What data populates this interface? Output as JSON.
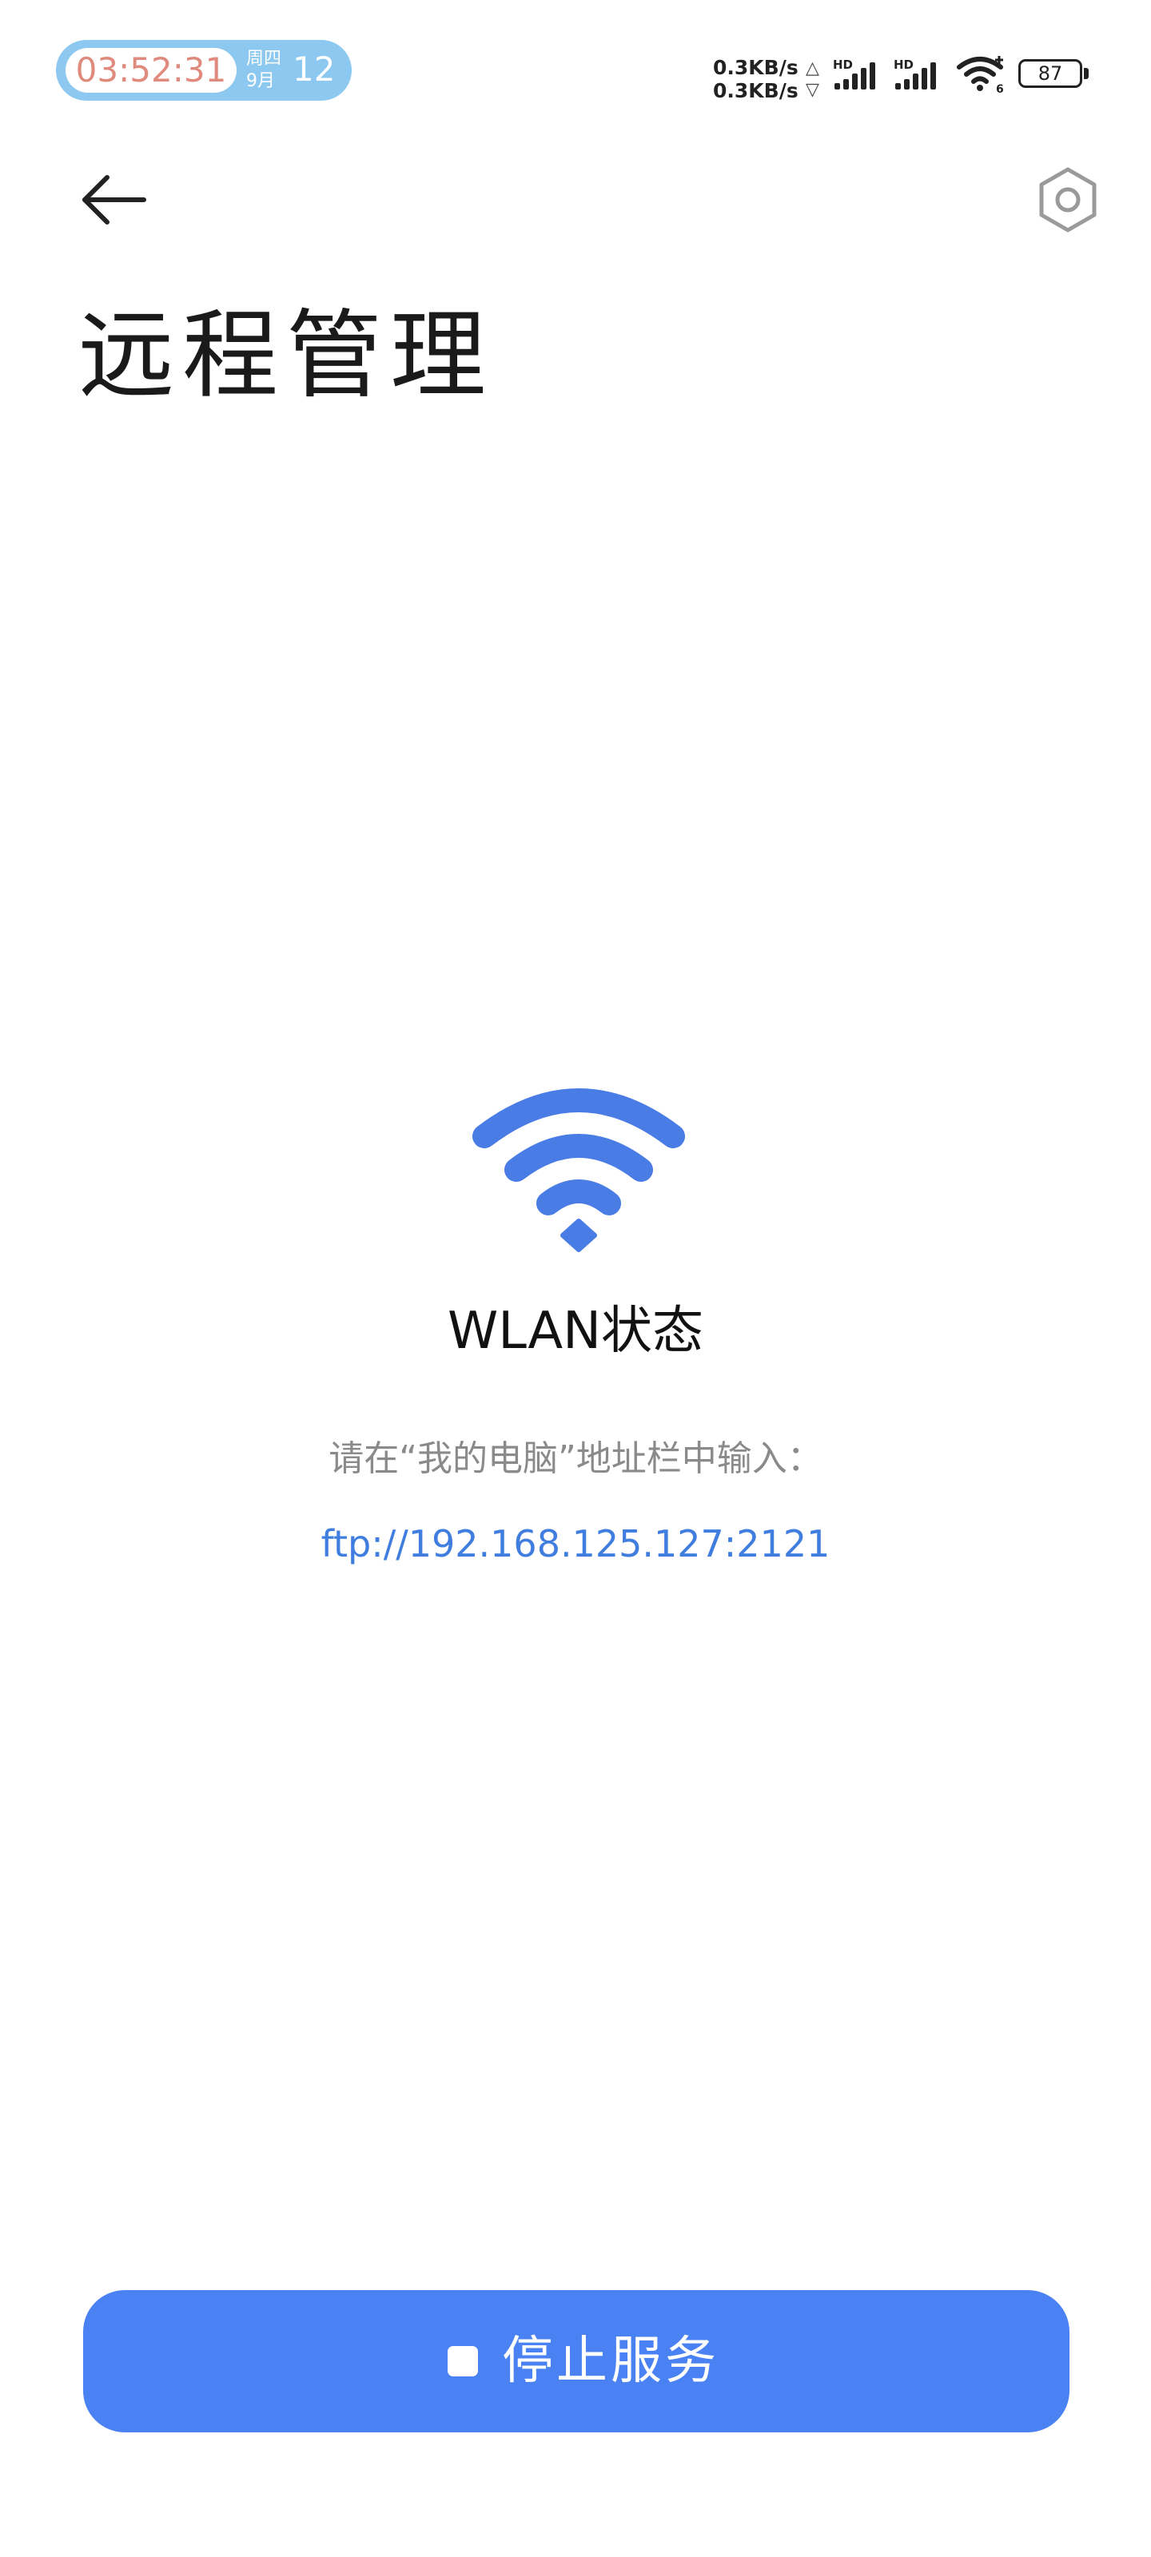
{
  "status_bar": {
    "time": "03:52:31",
    "weekday": "周四",
    "month": "9月",
    "day": "12",
    "upload_speed": "0.3KB/s",
    "download_speed": "0.3KB/s",
    "upload_arrow": "△",
    "download_arrow": "▽",
    "signal_tag": "HD",
    "wifi_tag": "6",
    "battery_level": "87",
    "icons": [
      "signal-hd-icon",
      "signal-hd-icon",
      "wifi-6-icon",
      "battery-icon"
    ]
  },
  "header": {
    "title": "远程管理",
    "back_icon": "arrow-left-icon",
    "settings_icon": "hexagon-gear-icon"
  },
  "main": {
    "status_icon": "wifi-icon",
    "status_title": "WLAN状态",
    "hint": "请在“我的电脑”地址栏中输入：",
    "ftp_address": "ftp://192.168.125.127:2121"
  },
  "footer": {
    "button_label": "停止服务",
    "button_icon": "stop-square-icon"
  },
  "colors": {
    "accent": "#4a82f3",
    "link": "#3f7ddf",
    "hint_text": "#8a8a8a",
    "clock_pill": "#8cc8f0",
    "clock_time": "#e08a7e",
    "background": "#ffffff"
  }
}
